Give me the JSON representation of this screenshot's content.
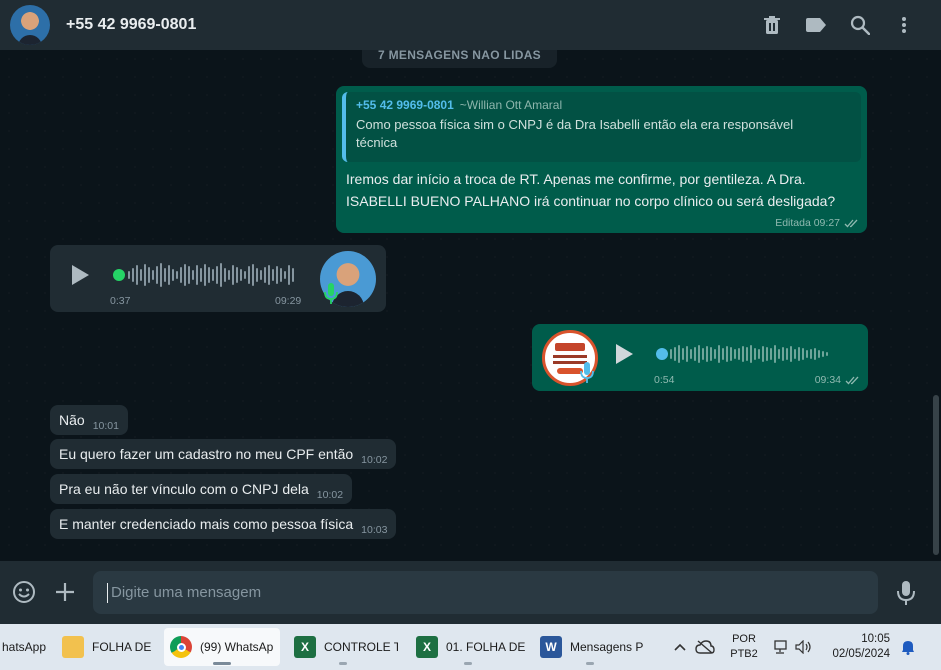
{
  "header": {
    "contact_name": "+55 42 9969-0801",
    "icons": [
      "trash-icon",
      "label-icon",
      "search-icon",
      "more-vertical-icon"
    ]
  },
  "chat": {
    "unread_pill": "7 MENSAGENS NÃO LIDAS",
    "reply_message": {
      "quote_author": "+55 42 9969-0801",
      "quote_author_sub": "~Willian Ott Amaral",
      "quote_text_line1": "Como pessoa física sim o CNPJ é da Dra Isabelli então ela era responsável",
      "quote_text_line2": "técnica",
      "text_line1": "Iremos dar início a troca de RT. Apenas me confirme, por gentileza. A Dra.",
      "text_line2": "ISABELLI BUENO PALHANO irá continuar no corpo clínico ou será desligada?",
      "meta": "Editada 09:27"
    },
    "incoming_audio": {
      "duration": "0:37",
      "time": "09:29"
    },
    "outgoing_audio": {
      "duration": "0:54",
      "time": "09:34"
    },
    "small_messages": [
      {
        "text": "Não",
        "time": "10:01"
      },
      {
        "text": "Eu quero fazer um cadastro no meu CPF então",
        "time": "10:02"
      },
      {
        "text": "Pra eu não ter vínculo com o CNPJ dela",
        "time": "10:02"
      },
      {
        "text": "E manter credenciado mais como pessoa física",
        "time": "10:03"
      }
    ]
  },
  "composer": {
    "placeholder": "Digite uma mensagem"
  },
  "taskbar": {
    "items": [
      {
        "label": "hatsApp"
      },
      {
        "label": "FOLHA DE"
      },
      {
        "label": "(99) WhatsAp"
      },
      {
        "label": "CONTROLE TI"
      },
      {
        "label": "01. FOLHA DE"
      },
      {
        "label": "Mensagens P"
      }
    ],
    "language_line1": "POR",
    "language_line2": "PTB2",
    "clock_time": "10:05",
    "clock_date": "02/05/2024"
  },
  "colors": {
    "header_bg": "#202c33",
    "chat_bg": "#0b141a",
    "bubble_out": "#005c4b",
    "bubble_in": "#202c33",
    "accent_blue": "#53bdeb",
    "accent_green": "#25d366"
  }
}
